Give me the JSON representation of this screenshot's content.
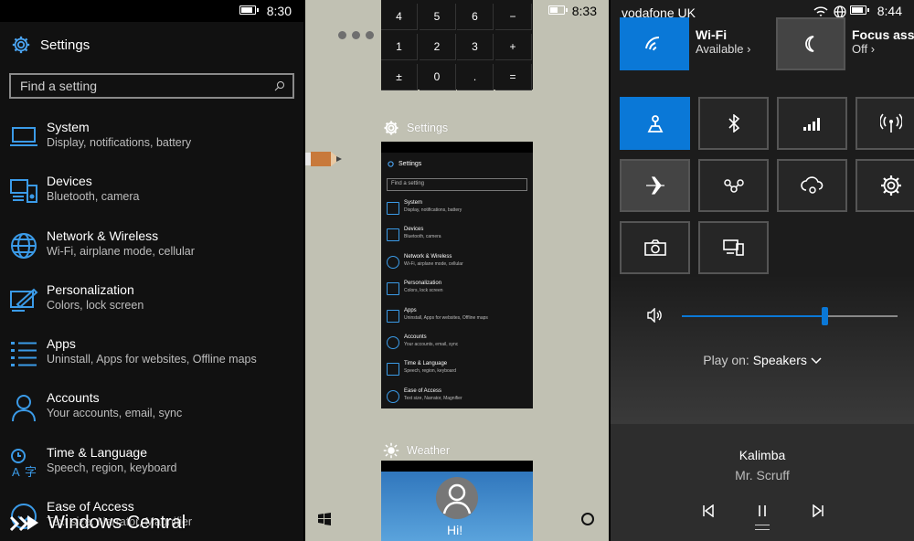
{
  "left_phone": {
    "time": "8:30",
    "header": "Settings",
    "search_placeholder": "Find a setting",
    "items": [
      {
        "title": "System",
        "sub": "Display, notifications, battery",
        "icon": "laptop-icon"
      },
      {
        "title": "Devices",
        "sub": "Bluetooth, camera",
        "icon": "devices-icon"
      },
      {
        "title": "Network & Wireless",
        "sub": "Wi-Fi, airplane mode, cellular",
        "icon": "globe-icon"
      },
      {
        "title": "Personalization",
        "sub": "Colors, lock screen",
        "icon": "paint-icon"
      },
      {
        "title": "Apps",
        "sub": "Uninstall, Apps for websites, Offline maps",
        "icon": "apps-list-icon"
      },
      {
        "title": "Accounts",
        "sub": "Your accounts, email, sync",
        "icon": "person-icon"
      },
      {
        "title": "Time & Language",
        "sub": "Speech, region, keyboard",
        "icon": "time-language-icon"
      },
      {
        "title": "Ease of Access",
        "sub": "Text size, Narrator, Magnifier",
        "icon": "ease-of-access-icon"
      }
    ]
  },
  "watermark": "Windows Central",
  "middle_phone": {
    "time": "8:33",
    "keypad": [
      "4",
      "5",
      "6",
      "−",
      "1",
      "2",
      "3",
      "+",
      "±",
      "0",
      ".",
      "="
    ],
    "settings_label": "Settings",
    "weather_label": "Weather",
    "weather_greeting": "Hi!",
    "thumb": {
      "header": "Settings",
      "search": "Find a setting",
      "items": [
        {
          "title": "System",
          "sub": "Display, notifications, battery"
        },
        {
          "title": "Devices",
          "sub": "Bluetooth, camera"
        },
        {
          "title": "Network & Wireless",
          "sub": "Wi-Fi, airplane mode, cellular"
        },
        {
          "title": "Personalization",
          "sub": "Colors, lock screen"
        },
        {
          "title": "Apps",
          "sub": "Uninstall, Apps for websites, Offline maps"
        },
        {
          "title": "Accounts",
          "sub": "Your accounts, email, sync"
        },
        {
          "title": "Time & Language",
          "sub": "Speech, region, keyboard"
        },
        {
          "title": "Ease of Access",
          "sub": "Text size, Narrator, Magnifier"
        }
      ]
    }
  },
  "right_phone": {
    "time": "8:44",
    "carrier": "vodafone UK",
    "wifi_title": "Wi-Fi",
    "wifi_status": "Available",
    "focus_title": "Focus assis",
    "focus_status": "Off",
    "play_on_prefix": "Play on:",
    "play_on_device": "Speakers",
    "song": "Kalimba",
    "artist": "Mr. Scruff",
    "volume_fraction": 0.66,
    "accent": "#0a78d7"
  }
}
